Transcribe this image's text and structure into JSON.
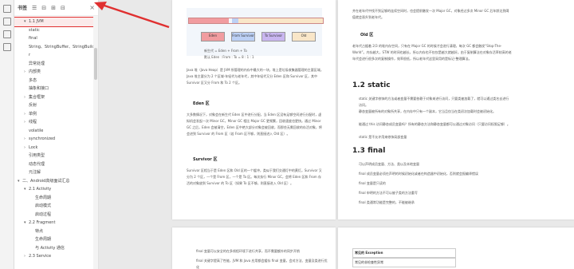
{
  "panel": {
    "title": "书签",
    "toolbar": [
      "☰",
      "⊟",
      "⊞",
      "⊟"
    ],
    "close": "×"
  },
  "outline": [
    {
      "label": "1.1 JVM",
      "level": 1,
      "caret": "▾",
      "selected": true
    },
    {
      "label": "static",
      "level": 1,
      "caret": ""
    },
    {
      "label": "final",
      "level": 1,
      "caret": ""
    },
    {
      "label": "String、StringBuffer、StringBuilde",
      "level": 1,
      "caret": ""
    },
    {
      "label": "r",
      "level": 1,
      "caret": ""
    },
    {
      "label": "异常处理",
      "level": 1,
      "caret": ""
    },
    {
      "label": "内部类",
      "level": 1,
      "caret": "›"
    },
    {
      "label": "多态",
      "level": 1,
      "caret": ""
    },
    {
      "label": "抽象和接口",
      "level": 1,
      "caret": ""
    },
    {
      "label": "集合框架",
      "level": 1,
      "caret": "›"
    },
    {
      "label": "反射",
      "level": 1,
      "caret": ""
    },
    {
      "label": "单例",
      "level": 1,
      "caret": "›"
    },
    {
      "label": "线程",
      "level": 1,
      "caret": "›"
    },
    {
      "label": "volatile",
      "level": 1,
      "caret": ""
    },
    {
      "label": "synchronized",
      "level": 1,
      "caret": "›"
    },
    {
      "label": "Lock",
      "level": 1,
      "caret": "›"
    },
    {
      "label": "引用类型",
      "level": 1,
      "caret": ""
    },
    {
      "label": "动态代理",
      "level": 1,
      "caret": ""
    },
    {
      "label": "元注解",
      "level": 1,
      "caret": ""
    },
    {
      "label": "二、Android高级面试汇总",
      "level": 0,
      "caret": "▾"
    },
    {
      "label": "2.1 Activity",
      "level": 1,
      "caret": "▾"
    },
    {
      "label": "生命周期",
      "level": 2,
      "caret": ""
    },
    {
      "label": "启动模式",
      "level": 2,
      "caret": ""
    },
    {
      "label": "启动过程",
      "level": 2,
      "caret": ""
    },
    {
      "label": "2.2 Fragment",
      "level": 1,
      "caret": "▾"
    },
    {
      "label": "特点",
      "level": 2,
      "caret": ""
    },
    {
      "label": "生命周期",
      "level": 2,
      "caret": ""
    },
    {
      "label": "与 Activity 通信",
      "level": 2,
      "caret": ""
    },
    {
      "label": "2.3 Service",
      "level": 1,
      "caret": "›"
    }
  ],
  "page1": {
    "fig_boxes": [
      "Eden",
      "From\nSurvivor",
      "To\nSurvivor",
      "Old"
    ],
    "fig_note1": "新生代 = Eden + From + To",
    "fig_note2": "默认 Eden : From : To = 8 : 1 : 1",
    "para1": "Java 堆（Java Heap）是 JVM 所管理的内存中最大的一块，堆上是垃圾收集器管理的主要区域。Java 堆主要分为 2 个区域-年轻代与老年代，其中年轻代又分 Eden 区和 Survivor 区，其中 Survivor 区又分 From 和 To 2 个区。",
    "h_eden": "Eden 区",
    "para2": "大多数情况下，对象会在新生代 Eden 区中进行分配，当 Eden 区没有足够空间进行分配时，虚拟机会发起一次 Minor GC，Minor GC 相比 Major GC 更频繁，回收速度也更快。通过 Minor GC 之后，Eden 会被清空，Eden 区中绝大部分对象会被回收，而那些无需回收的存活对象，将会进到 Survivor 的 From 区（若 From 区不够，则直接进入 Old 区）。",
    "h_survivor": "Survivor 区",
    "para3": "Survivor 区相当于是 Eden 区和 Old 区的一个缓冲，类似于我们交通灯中的黄灯。Survivor 又分为 2 个区，一个是 From 区，一个是 To 区。每次执行 Minor GC，会将 Eden 区和 From 存活的对象放到 Survivor 的 To 区（如果 To 区不够，则直接进入 Old 区）。"
  },
  "page2": {
    "para0": "并在老年代中找不到足够的连续空间时，也会提前触发一次 Major GC，对象经过多次 Minor GC 后年龄达到阈值就会晋升到老年代。",
    "h_old": "Old 区",
    "para1": "老年代占据着 2/3 的堆内存空间，只有在 Major GC 的时候才会进行清理，每次 GC 都会触发“Stop-The-World”。内存越大，STW 的时间也越长，所以内存也不仅仅是越大就越好。由于复制算法在对象存活率较高的老年代会进行很多次的复制操作，效率很低，所以老年代这里采用的是标记-整理算法。",
    "h_static": "1.2 static",
    "static_items": [
      "static 关键字修饰的方法或者变量不需要依赖于对象来进行访问，只要类被加载了，就可以通过类名去进行访问。",
      "静态变量被所有的对象所共享，在内存中只有一个副本，它当且仅当在类初次加载时会被初始化。",
      "能通过 this 访问静态成员变量吗？所有的静态方法和静态变量都可以通过对象访问（只要访问权限足够）。",
      "static 是不允许用来修饰局部变量"
    ],
    "h_final": "1.3 final",
    "final_items": [
      "可以声明成员变量、方法、类以及本地变量",
      "final 成员变量必须在声明的时候初始化或者在构造器中初始化，否则就会报编译错误",
      "final 变量是只读的",
      "final 申明的方法不可以被子类的方法重写",
      "final 类通常功能是完整的，不能被继承"
    ]
  },
  "page3": {
    "items": [
      "final 变量可以安全的在多线程环境下进行共享，而不需要额外的同步开销",
      "final 关键字提高了性能，JVM 和 Java 应用都会缓存 final 变量，会对方法、变量及类进行优化"
    ]
  },
  "page4": {
    "table_header": "常见的 Exception",
    "table_row": "常见的非检查性异常"
  },
  "colors": {
    "highlight": "#e03030",
    "eden": "#f19ca0",
    "survivor": "#bcd0f5",
    "old": "#f9e6c8"
  }
}
